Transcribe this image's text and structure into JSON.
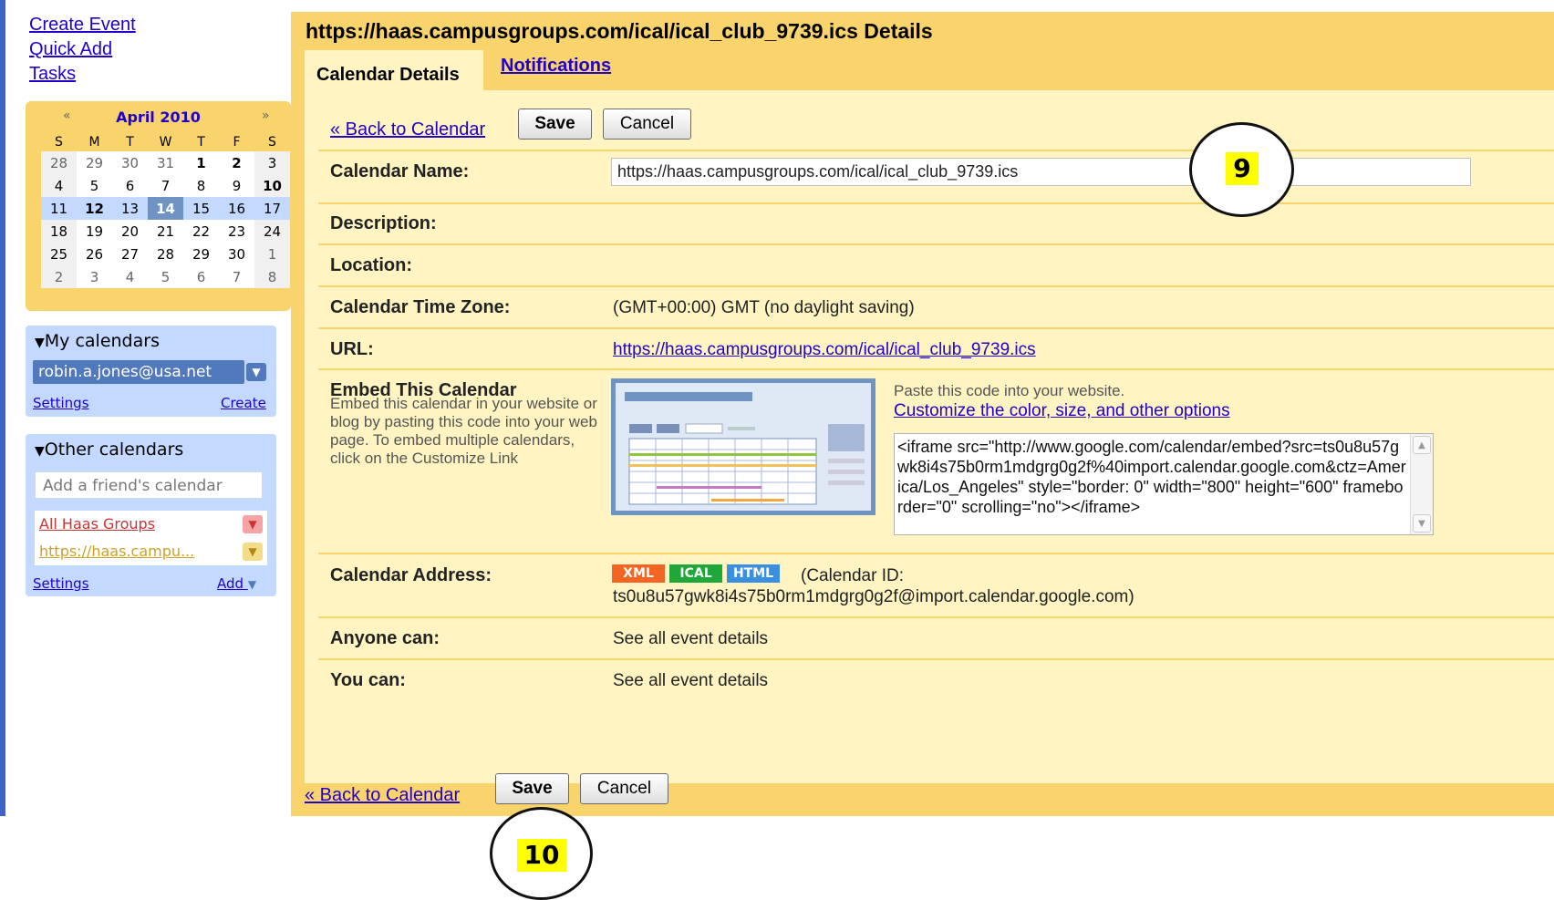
{
  "sidebar": {
    "links": [
      "Create Event",
      "Quick Add",
      "Tasks"
    ],
    "mini_calendar": {
      "month": "April 2010",
      "prev": "«",
      "next": "»",
      "weekdays": [
        "S",
        "M",
        "T",
        "W",
        "T",
        "F",
        "S"
      ],
      "weeks": [
        [
          "28",
          "29",
          "30",
          "31",
          "1",
          "2",
          "3"
        ],
        [
          "4",
          "5",
          "6",
          "7",
          "8",
          "9",
          "10"
        ],
        [
          "11",
          "12",
          "13",
          "14",
          "15",
          "16",
          "17"
        ],
        [
          "18",
          "19",
          "20",
          "21",
          "22",
          "23",
          "24"
        ],
        [
          "25",
          "26",
          "27",
          "28",
          "29",
          "30",
          "1"
        ],
        [
          "2",
          "3",
          "4",
          "5",
          "6",
          "7",
          "8"
        ]
      ],
      "today": "14"
    },
    "my_calendars": {
      "title": "My calendars",
      "item": "robin.a.jones@usa.net",
      "settings": "Settings",
      "create": "Create"
    },
    "other_calendars": {
      "title": "Other calendars",
      "placeholder": "Add a friend's calendar",
      "items": [
        {
          "label": "All Haas Groups",
          "color": "#cc3333"
        },
        {
          "label": "https://haas.campu...",
          "color": "#c9a227"
        }
      ],
      "settings": "Settings",
      "add": "Add"
    }
  },
  "main": {
    "title": "https://haas.campusgroups.com/ical/ical_club_9739.ics Details",
    "tabs": {
      "active": "Calendar Details",
      "other": "Notifications"
    },
    "back_link": "« Back to Calendar",
    "save": "Save",
    "cancel": "Cancel",
    "fields": {
      "name_label": "Calendar Name:",
      "name_value": "https://haas.campusgroups.com/ical/ical_club_9739.ics",
      "description_label": "Description:",
      "location_label": "Location:",
      "timezone_label": "Calendar Time Zone:",
      "timezone_value": "(GMT+00:00) GMT (no daylight saving)",
      "url_label": "URL:",
      "url_value": "https://haas.campusgroups.com/ical/ical_club_9739.ics",
      "embed_label": "Embed This Calendar",
      "embed_desc": "Embed this calendar in your website or blog by pasting this code into your web page. To embed multiple calendars, click on the Customize Link",
      "paste_text": "Paste this code into your website.",
      "customize_link": "Customize the color, size, and other options",
      "embed_code": "<iframe src=\"http://www.google.com/calendar/embed?src=ts0u8u57gwk8i4s75b0rm1mdgrg0g2f%40import.calendar.google.com&ctz=America/Los_Angeles\" style=\"border: 0\" width=\"800\" height=\"600\" frameborder=\"0\" scrolling=\"no\"></iframe>",
      "address_label": "Calendar Address:",
      "badges": {
        "xml": "XML",
        "ical": "ICAL",
        "html": "HTML"
      },
      "calendar_id_prefix": "(Calendar ID:",
      "calendar_id": "ts0u8u57gwk8i4s75b0rm1mdgrg0g2f@import.calendar.google.com)",
      "anyone_label": "Anyone can:",
      "anyone_value": "See all event details",
      "you_label": "You can:",
      "you_value": "See all event details"
    }
  },
  "callouts": {
    "step_9": "9",
    "step_10": "10"
  },
  "colors": {
    "panel": "#f9d46c",
    "panel_light": "#fff4c2",
    "link": "#2200cc",
    "callout_fill": "#ffff00"
  }
}
